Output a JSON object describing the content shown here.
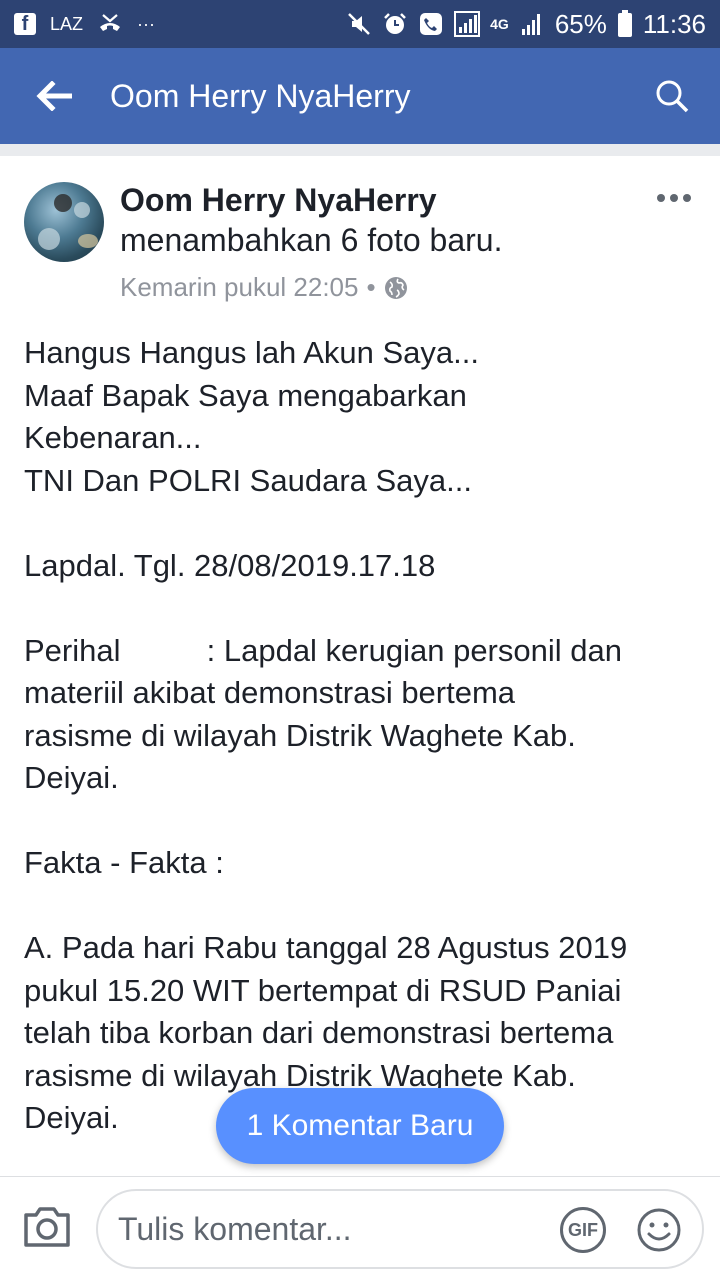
{
  "status_bar": {
    "laz_label": "LAZ",
    "dots": "···",
    "network_label": "4G",
    "battery": "65%",
    "time": "11:36"
  },
  "app_bar": {
    "title": "Oom Herry NyaHerry"
  },
  "post": {
    "author": "Oom Herry NyaHerry",
    "action": "menambahkan 6 foto baru.",
    "timestamp": "Kemarin pukul 22:05",
    "separator": "•",
    "lines": [
      "Hangus Hangus lah Akun Saya...",
      "Maaf Bapak Saya mengabarkan",
      "Kebenaran...",
      "TNI Dan POLRI Saudara Saya...",
      "",
      "Lapdal. Tgl. 28/08/2019.17.18",
      "",
      "Perihal          : Lapdal kerugian personil dan",
      "materiil akibat demonstrasi bertema",
      "rasisme di wilayah Distrik Waghete Kab.",
      "Deiyai.",
      "",
      "Fakta - Fakta :",
      "",
      "A. Pada hari Rabu tanggal 28 Agustus 2019",
      "pukul 15.20 WIT bertempat di RSUD Paniai",
      "telah tiba korban dari demonstrasi bertema",
      "rasisme di wilayah Distrik Waghete Kab.",
      "Deiyai."
    ]
  },
  "new_comment_pill": {
    "label": "1 Komentar Baru"
  },
  "comment_bar": {
    "placeholder": "Tulis komentar...",
    "gif_label": "GIF"
  },
  "colors": {
    "status_bar": "#2d4373",
    "app_bar": "#4267b2",
    "pill": "#5890ff",
    "meta_text": "#90949c"
  }
}
